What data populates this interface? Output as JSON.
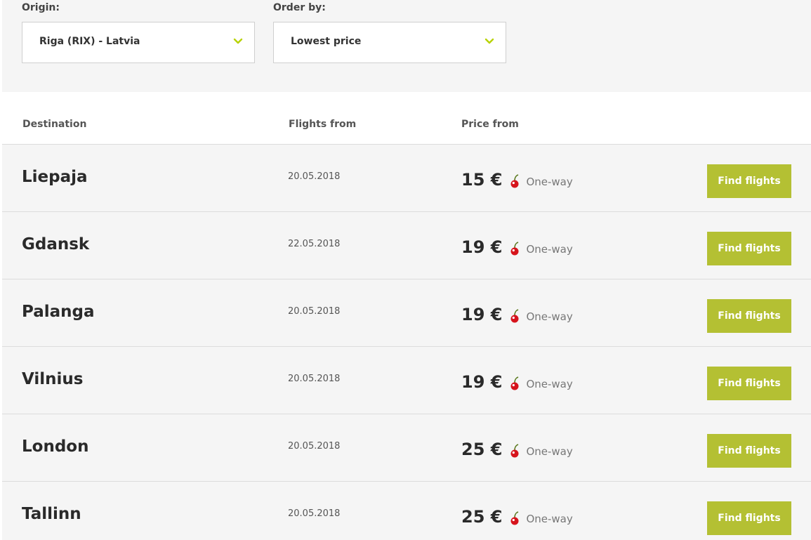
{
  "filters": {
    "origin": {
      "label": "Origin:",
      "value": "Riga (RIX) - Latvia",
      "icon": "chevron-down-icon"
    },
    "order": {
      "label": "Order by:",
      "value": "Lowest price",
      "icon": "chevron-down-icon"
    }
  },
  "table": {
    "headers": {
      "destination": "Destination",
      "flights_from": "Flights from",
      "price_from": "Price from"
    },
    "rows": [
      {
        "destination": "Liepaja",
        "date": "20.05.2018",
        "price": "15 €",
        "trip": "One-way",
        "button": "Find flights"
      },
      {
        "destination": "Gdansk",
        "date": "22.05.2018",
        "price": "19 €",
        "trip": "One-way",
        "button": "Find flights"
      },
      {
        "destination": "Palanga",
        "date": "20.05.2018",
        "price": "19 €",
        "trip": "One-way",
        "button": "Find flights"
      },
      {
        "destination": "Vilnius",
        "date": "20.05.2018",
        "price": "19 €",
        "trip": "One-way",
        "button": "Find flights"
      },
      {
        "destination": "London",
        "date": "20.05.2018",
        "price": "25 €",
        "trip": "One-way",
        "button": "Find flights"
      },
      {
        "destination": "Tallinn",
        "date": "20.05.2018",
        "price": "25 €",
        "trip": "One-way",
        "button": "Find flights"
      }
    ]
  },
  "colors": {
    "accent": "#b4c033",
    "chevron": "#b8d200",
    "cherry": "#d6141c",
    "row_bg": "#f5f5f5"
  },
  "icons": {
    "price_badge": "cherry-icon"
  }
}
